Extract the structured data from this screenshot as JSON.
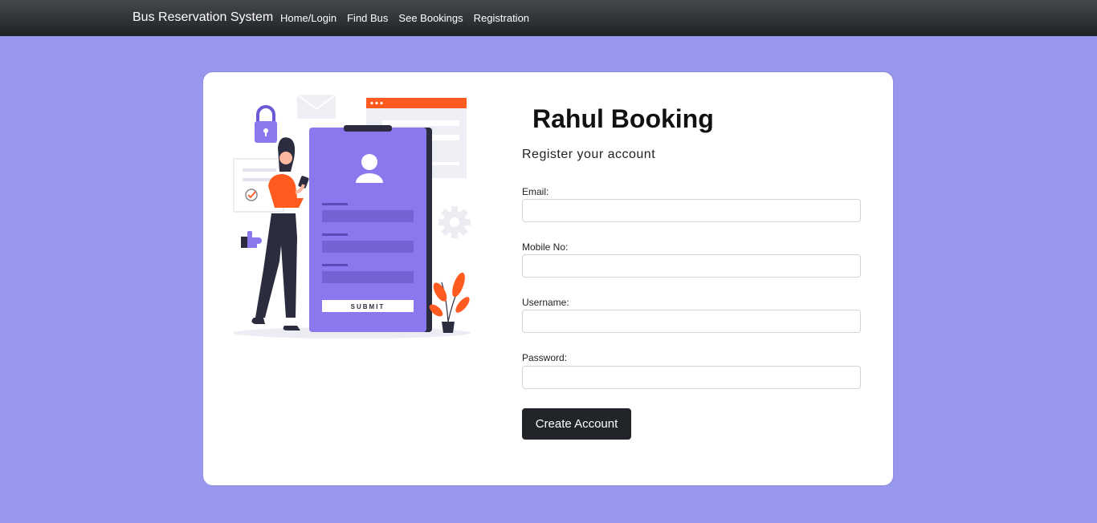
{
  "navbar": {
    "brand": "Bus Reservation System",
    "links": [
      "Home/Login",
      "Find Bus",
      "See Bookings",
      "Registration"
    ]
  },
  "illustration": {
    "submit_label": "SUBMIT",
    "icons": [
      "lock-icon",
      "envelope-icon",
      "gear-icon",
      "thumbs-up-icon",
      "checkmark-icon",
      "user-icon"
    ]
  },
  "form": {
    "title": "Rahul Booking",
    "subtitle": "Register your account",
    "fields": [
      {
        "label": "Email:",
        "value": ""
      },
      {
        "label": "Mobile No:",
        "value": ""
      },
      {
        "label": "Username:",
        "value": ""
      },
      {
        "label": "Password:",
        "value": ""
      }
    ],
    "submit": "Create Account"
  },
  "colors": {
    "background": "#9797ee",
    "navbar": "#2b2e33",
    "button": "#212529",
    "accent_orange": "#ff5a1f",
    "accent_purple": "#8b78ee"
  }
}
